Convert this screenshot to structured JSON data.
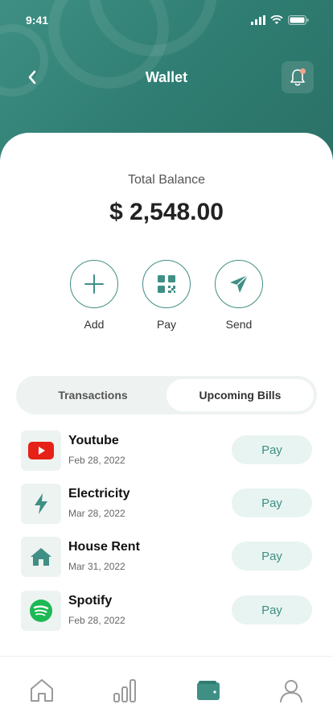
{
  "status_bar": {
    "time": "9:41"
  },
  "header": {
    "title": "Wallet"
  },
  "balance": {
    "label": "Total Balance",
    "value": "$ 2,548.00"
  },
  "actions": [
    {
      "label": "Add",
      "icon": "plus-icon"
    },
    {
      "label": "Pay",
      "icon": "qr-code-icon"
    },
    {
      "label": "Send",
      "icon": "send-icon"
    }
  ],
  "tabs": [
    {
      "label": "Transactions",
      "active": false
    },
    {
      "label": "Upcoming Bills",
      "active": true
    }
  ],
  "bills": [
    {
      "name": "Youtube",
      "date": "Feb 28, 2022",
      "action": "Pay",
      "icon": "youtube-icon"
    },
    {
      "name": "Electricity",
      "date": "Mar 28, 2022",
      "action": "Pay",
      "icon": "lightning-icon"
    },
    {
      "name": "House Rent",
      "date": "Mar 31, 2022",
      "action": "Pay",
      "icon": "house-icon"
    },
    {
      "name": "Spotify",
      "date": "Feb 28, 2022",
      "action": "Pay",
      "icon": "spotify-icon"
    }
  ],
  "bottom_nav": [
    {
      "icon": "home-icon",
      "active": false
    },
    {
      "icon": "stats-icon",
      "active": false
    },
    {
      "icon": "wallet-icon",
      "active": true
    },
    {
      "icon": "profile-icon",
      "active": false
    }
  ],
  "colors": {
    "accent": "#3f8f84",
    "header_bg": "#2f7d72",
    "pay_button_bg": "#e8f4f1",
    "notification_dot": "#f4a48a",
    "youtube_red": "#e62117",
    "spotify_green": "#1db954"
  }
}
